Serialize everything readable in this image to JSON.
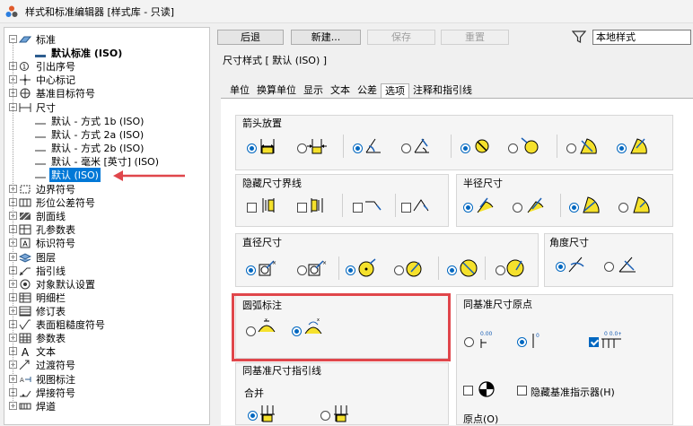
{
  "window": {
    "title": "样式和标准编辑器 [样式库 - 只读]"
  },
  "tree": {
    "items": [
      {
        "label": "标准",
        "level": 0,
        "expander": "minus",
        "icon": "standard-icon"
      },
      {
        "label": "默认标准 (ISO)",
        "level": 1,
        "expander": "none",
        "icon": "standard-doc-icon",
        "bold": true
      },
      {
        "label": "引出序号",
        "level": 0,
        "expander": "plus",
        "icon": "balloon-icon"
      },
      {
        "label": "中心标记",
        "level": 0,
        "expander": "plus",
        "icon": "center-mark-icon"
      },
      {
        "label": "基准目标符号",
        "level": 0,
        "expander": "plus",
        "icon": "datum-target-icon"
      },
      {
        "label": "尺寸",
        "level": 0,
        "expander": "minus",
        "icon": "dimension-icon"
      },
      {
        "label": "默认 - 方式 1b (ISO)",
        "level": 1,
        "expander": "none",
        "icon": "style-line-icon"
      },
      {
        "label": "默认 - 方式 2a (ISO)",
        "level": 1,
        "expander": "none",
        "icon": "style-line-icon"
      },
      {
        "label": "默认 - 方式 2b (ISO)",
        "level": 1,
        "expander": "none",
        "icon": "style-line-icon"
      },
      {
        "label": "默认 - 毫米 [英寸] (ISO)",
        "level": 1,
        "expander": "none",
        "icon": "style-line-icon"
      },
      {
        "label": "默认 (ISO)",
        "level": 1,
        "expander": "none",
        "icon": "style-line-icon",
        "selected": true
      },
      {
        "label": "边界符号",
        "level": 0,
        "expander": "plus",
        "icon": "boundary-icon"
      },
      {
        "label": "形位公差符号",
        "level": 0,
        "expander": "plus",
        "icon": "gdt-icon"
      },
      {
        "label": "剖面线",
        "level": 0,
        "expander": "plus",
        "icon": "hatch-icon"
      },
      {
        "label": "孔参数表",
        "level": 0,
        "expander": "plus",
        "icon": "hole-table-icon"
      },
      {
        "label": "标识符号",
        "level": 0,
        "expander": "plus",
        "icon": "id-symbol-icon"
      },
      {
        "label": "图层",
        "level": 0,
        "expander": "plus",
        "icon": "layers-icon"
      },
      {
        "label": "指引线",
        "level": 0,
        "expander": "plus",
        "icon": "leader-icon"
      },
      {
        "label": "对象默认设置",
        "level": 0,
        "expander": "plus",
        "icon": "object-defaults-icon"
      },
      {
        "label": "明细栏",
        "level": 0,
        "expander": "plus",
        "icon": "parts-list-icon"
      },
      {
        "label": "修订表",
        "level": 0,
        "expander": "plus",
        "icon": "revision-table-icon"
      },
      {
        "label": "表面粗糙度符号",
        "level": 0,
        "expander": "plus",
        "icon": "surface-texture-icon"
      },
      {
        "label": "参数表",
        "level": 0,
        "expander": "plus",
        "icon": "table-icon"
      },
      {
        "label": "文本",
        "level": 0,
        "expander": "plus",
        "icon": "text-icon"
      },
      {
        "label": "过渡符号",
        "level": 0,
        "expander": "plus",
        "icon": "weld-bead-icon"
      },
      {
        "label": "视图标注",
        "level": 0,
        "expander": "plus",
        "icon": "view-annotation-icon"
      },
      {
        "label": "焊接符号",
        "level": 0,
        "expander": "plus",
        "icon": "weld-symbol-icon"
      },
      {
        "label": "焊道",
        "level": 0,
        "expander": "plus",
        "icon": "weld-icon"
      }
    ]
  },
  "toolbar": {
    "back": "后退",
    "new": "新建...",
    "save": "保存",
    "reset": "重置",
    "filter_value": "本地样式"
  },
  "style_header": "尺寸样式 [ 默认 (ISO) ]",
  "tabs": [
    "单位",
    "换算单位",
    "显示",
    "文本",
    "公差",
    "选项",
    "注释和指引线"
  ],
  "active_tab": "选项",
  "groups": {
    "arrowhead": "箭头放置",
    "hide_ext": "隐藏尺寸界线",
    "radius": "半径尺寸",
    "diameter": "直径尺寸",
    "angular": "角度尺寸",
    "arc_length": "圆弧标注",
    "baseline_origin": "同基准尺寸原点",
    "baseline_leader": "同基准尺寸指引线",
    "merge": "合并",
    "hide_origin_indicator": "隐藏基准指示器(H)",
    "origin_label": "原点(O)"
  },
  "colors": {
    "accent": "#0067c0",
    "highlight": "#e0464b",
    "symbol_fill": "#f5e12c"
  }
}
